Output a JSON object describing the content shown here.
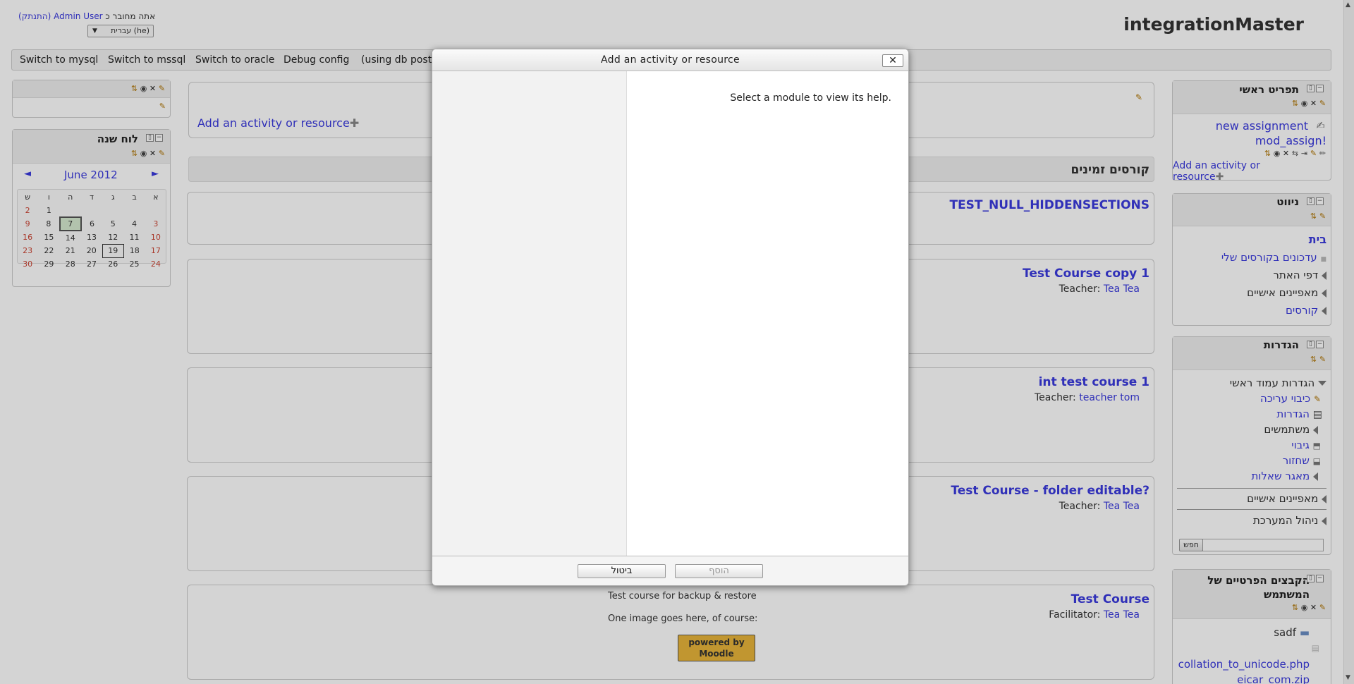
{
  "header": {
    "site_name": "integrationMaster",
    "logged_in_prefix": "אתה מחובר כ",
    "user": "Admin User",
    "logout": "(התנתק)",
    "language": "עברית (he)"
  },
  "topbar": {
    "items": [
      "Switch to mysql",
      "Switch to mssql",
      "Switch to oracle",
      "Debug config",
      "(using db postgr"
    ]
  },
  "main_menu_area": {
    "add_label": "Add an activity or resource"
  },
  "available_courses": {
    "heading": "קורסים זמינים"
  },
  "courses": [
    {
      "title": "TEST_NULL_HIDDENSECTIONS",
      "role": "",
      "teacher": ""
    },
    {
      "title": "Test Course copy 1",
      "role": "Teacher:",
      "teacher": "Tea Tea"
    },
    {
      "title": "int test course 1",
      "role": "Teacher:",
      "teacher": "teacher tom"
    },
    {
      "title": "Test Course - folder editable?",
      "role": "Teacher:",
      "teacher": "Tea Tea"
    },
    {
      "title": "Test Course",
      "role": "Facilitator:",
      "teacher": "Tea Tea",
      "summary1": "Test course for backup & restore",
      "summary2": "One image goes here, of course:",
      "logo_text": "powered by Moodle"
    }
  ],
  "calendar": {
    "title": "לוח שנה",
    "month": "June 2012",
    "prev": "◄",
    "next": "►",
    "days": [
      "א",
      "ב",
      "ג",
      "ד",
      "ה",
      "ו",
      "ש"
    ],
    "weeks": [
      [
        "",
        "",
        "",
        "",
        "",
        "1",
        "2"
      ],
      [
        "3",
        "4",
        "5",
        "6",
        "7",
        "8",
        "9"
      ],
      [
        "10",
        "11",
        "12",
        "13",
        "14",
        "15",
        "16"
      ],
      [
        "17",
        "18",
        "19",
        "20",
        "21",
        "22",
        "23"
      ],
      [
        "24",
        "25",
        "26",
        "27",
        "28",
        "29",
        "30"
      ]
    ]
  },
  "main_menu_block": {
    "title": "תפריט ראשי",
    "item1": "new assignment",
    "item2": "mod_assign!",
    "add": "Add an activity or resource"
  },
  "navigation": {
    "title": "ניווט",
    "home": "בית",
    "items": [
      "עדכונים בקורסים שלי",
      "דפי האתר",
      "מאפיינים אישיים",
      "קורסים"
    ]
  },
  "settings": {
    "title": "הגדרות",
    "front_page": "הגדרות עמוד ראשי",
    "items": [
      "כיבוי עריכה",
      "הגדרות",
      "משתמשים",
      "גיבוי",
      "שחזור",
      "מאגר שאלות"
    ],
    "personal": "מאפיינים אישיים",
    "admin": "ניהול המערכת",
    "search_button": "חפש",
    "search_value": ""
  },
  "private_files": {
    "title": "הקבצים הפרטיים של המשתמש",
    "files": [
      "sadf",
      "collation_to_unicode.php",
      "eicar_com.zip"
    ]
  },
  "dialog": {
    "title": "Add an activity or resource",
    "help": "Select a module to view its help.",
    "add_button": "הוסף",
    "cancel_button": "ביטול",
    "close": "✕"
  }
}
